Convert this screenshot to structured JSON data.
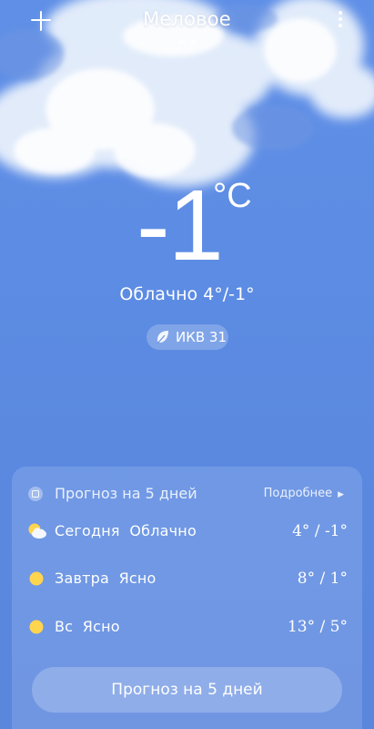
{
  "header": {
    "city": "Меловое"
  },
  "current": {
    "temperature": "-1",
    "unit": "°C",
    "condition": "Облачно",
    "high_low": "4°/-1°",
    "aqi_label": "ИКВ 31"
  },
  "forecast": {
    "title": "Прогноз на 5 дней",
    "more_label": "Подробнее",
    "days": [
      {
        "day": "Сегодня",
        "condition": "Облачно",
        "high": "4°",
        "low": "-1°",
        "icon": "partly-cloudy-icon"
      },
      {
        "day": "Завтра",
        "condition": "Ясно",
        "high": "8°",
        "low": "1°",
        "icon": "sun-icon"
      },
      {
        "day": "Вс",
        "condition": "Ясно",
        "high": "13°",
        "low": "5°",
        "icon": "sun-icon"
      }
    ],
    "button_label": "Прогноз на 5 дней"
  }
}
